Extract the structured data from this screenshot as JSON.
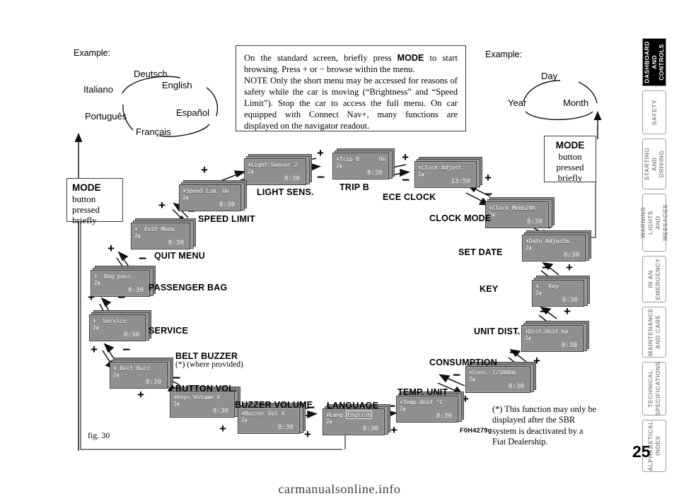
{
  "page": {
    "number": "25",
    "figure_label": "fig. 30",
    "figure_code": "F0H4279g",
    "watermark": "carmanualsonline.info"
  },
  "note_box": {
    "line1_a": "On the standard screen, briefly press ",
    "line1_b": "MODE",
    "line1_c": " to start browsing. Press + or − browse within the menu.",
    "line2": "NOTE  Only the short menu may be accessed for reasons of safety while the car is moving (“Brightness” and “Speed Limit”). Stop the car to access the full menu. On car equipped with  Connect Nav+, many functions are displayed on the navigator readout."
  },
  "mode_box_left": {
    "title": "MODE",
    "line1": "button",
    "line2": "pressed",
    "line3": "briefly"
  },
  "mode_box_right": {
    "title": "MODE",
    "line1": "button",
    "line2": "pressed",
    "line3": "briefly"
  },
  "example_left": {
    "label": "Example:",
    "items": [
      "Deutsch",
      "English",
      "Español",
      "Français",
      "Português",
      "Italiano"
    ]
  },
  "example_right": {
    "label": "Example:",
    "items": [
      "Day",
      "Month",
      "Year"
    ]
  },
  "footnote": "(*) This function may only be displayed after the SBR system is deactivated by a Fiat Dealership.",
  "plus": "+",
  "minus": "−",
  "displays": [
    {
      "id": "light-sensor",
      "caption": "LIGHT SENS.",
      "line1": "Light Sensor 2",
      "line1_right": "",
      "line2": "2",
      "line3": "8:30",
      "boxed": false
    },
    {
      "id": "speed-limit",
      "caption": "SPEED LIMIT",
      "line1": "Speed Lim. On",
      "line1_right": "",
      "line2": "2",
      "line3": "8:30",
      "boxed": false
    },
    {
      "id": "quit-menu",
      "caption": "QUIT MENU",
      "line1": "Exit Menu",
      "line1_right": "",
      "line2": "2",
      "line3": "8:30",
      "boxed": false
    },
    {
      "id": "passenger-bag",
      "caption": "PASSENGER BAG",
      "line1": "Bag pass.",
      "line1_right": "",
      "line2": "2",
      "line3": "8:30",
      "boxed": false
    },
    {
      "id": "service",
      "caption": "SERVICE",
      "line1": "Service",
      "line1_right": "",
      "line2": "2",
      "line3": "8:30",
      "boxed": false
    },
    {
      "id": "belt-buzzer",
      "caption": "BELT BUZZER",
      "line1": "Belt Buzz",
      "line1_right": "",
      "line2": "2",
      "line3": "8:30",
      "boxed": false
    },
    {
      "id": "button-vol",
      "caption": "BUTTON VOL.",
      "line1": "Keys Volume 4",
      "line1_right": "",
      "line2": "2",
      "line3": "8:30",
      "boxed": false
    },
    {
      "id": "buzzer-volume",
      "caption": "BUZZER  VOLUME",
      "line1": "Buzzer Vol 4",
      "line1_right": "",
      "line2": "2",
      "line3": "8:30",
      "boxed": false
    },
    {
      "id": "language",
      "caption": "LANGUAGE",
      "line1": "Lang.",
      "line1_right": "English",
      "line2": "2",
      "line3": "8:30",
      "boxed": true
    },
    {
      "id": "temp-unit",
      "caption": "TEMP. UNIT",
      "line1": "Temp.Unit °C",
      "line1_right": "",
      "line2": "2",
      "line3": "8:30",
      "boxed": false
    },
    {
      "id": "consumption",
      "caption": "CONSUMPTION",
      "line1": "Cons. l/100km",
      "line1_right": "",
      "line2": "2",
      "line3": "8:30",
      "boxed": false
    },
    {
      "id": "unit-dist",
      "caption": "UNIT DIST.",
      "line1": "Dist.Unit km",
      "line1_right": "",
      "line2": "2",
      "line3": "8:30",
      "boxed": false
    },
    {
      "id": "key",
      "caption": "KEY",
      "line1": "Key",
      "line1_right": "",
      "line2": "2",
      "line3": "8:30",
      "boxed": false
    },
    {
      "id": "set-date",
      "caption": "SET DATE",
      "line1": "Date Adjustm.",
      "line1_right": "",
      "line2": "2",
      "line3": "8:30",
      "boxed": false
    },
    {
      "id": "clock-mode",
      "caption": "CLOCK MODE",
      "line1": "Clock Mode24h",
      "line1_right": "",
      "line2": "2",
      "line3": "8:30",
      "boxed": false
    },
    {
      "id": "ece-clock",
      "caption": "ECE CLOCK",
      "line1": "Clock Adjust.",
      "line1_right": "",
      "line2": "2",
      "line3": "13:50",
      "boxed": false
    },
    {
      "id": "trip-b",
      "caption": "TRIP B",
      "line1": "Trip B",
      "line1_right": "On",
      "line2": "2",
      "line3": "8:30",
      "boxed": false
    }
  ],
  "sidebar": {
    "tabs": [
      {
        "label": "DASHBOARD\nAND CONTROLS",
        "active": true
      },
      {
        "label": "SAFETY",
        "active": false
      },
      {
        "label": "STARTING\nAND DRIVING",
        "active": false
      },
      {
        "label": "WARNING\nLIGHTS AND\nMESSAGES",
        "active": false
      },
      {
        "label": "IN AN\nEMERGENCY",
        "active": false
      },
      {
        "label": "MAINTENANCE\nAND CARE",
        "active": false
      },
      {
        "label": "TECHNICAL\nSPECIFICATIONS",
        "active": false
      },
      {
        "label": "ALPHABETICAL\nINDEX",
        "active": false
      }
    ]
  }
}
